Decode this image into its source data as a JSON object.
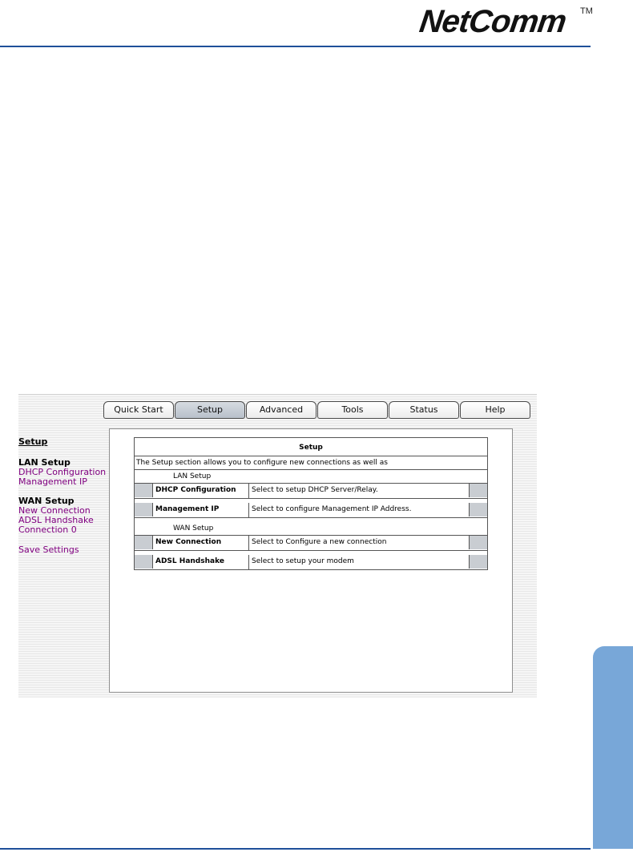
{
  "header": {
    "brand": "NetComm",
    "trademark": "TM"
  },
  "tabs": [
    {
      "label": "Quick Start",
      "active": false
    },
    {
      "label": "Setup",
      "active": true
    },
    {
      "label": "Advanced",
      "active": false
    },
    {
      "label": "Tools",
      "active": false
    },
    {
      "label": "Status",
      "active": false
    },
    {
      "label": "Help",
      "active": false
    }
  ],
  "sidebar": {
    "title": "Setup",
    "lan": {
      "heading": "LAN Setup",
      "items": [
        "DHCP Configuration",
        "Management IP"
      ]
    },
    "wan": {
      "heading": "WAN Setup",
      "items": [
        "New Connection",
        "ADSL Handshake",
        "Connection 0"
      ]
    },
    "save": "Save Settings"
  },
  "main": {
    "title": "Setup",
    "description": "The Setup section allows you to configure new connections as well as",
    "lan_section": "LAN Setup",
    "lan_rows": [
      {
        "label": "DHCP Configuration",
        "desc": "Select to setup DHCP Server/Relay."
      },
      {
        "label": "Management IP",
        "desc": "Select to configure Management IP Address."
      }
    ],
    "wan_section": "WAN Setup",
    "wan_rows": [
      {
        "label": "New Connection",
        "desc": "Select to Configure a new connection"
      },
      {
        "label": "ADSL Handshake",
        "desc": "Select to setup your modem"
      }
    ]
  },
  "colors": {
    "rule": "#1e4f99",
    "side_tab": "#78a7d8",
    "link": "#800080"
  }
}
